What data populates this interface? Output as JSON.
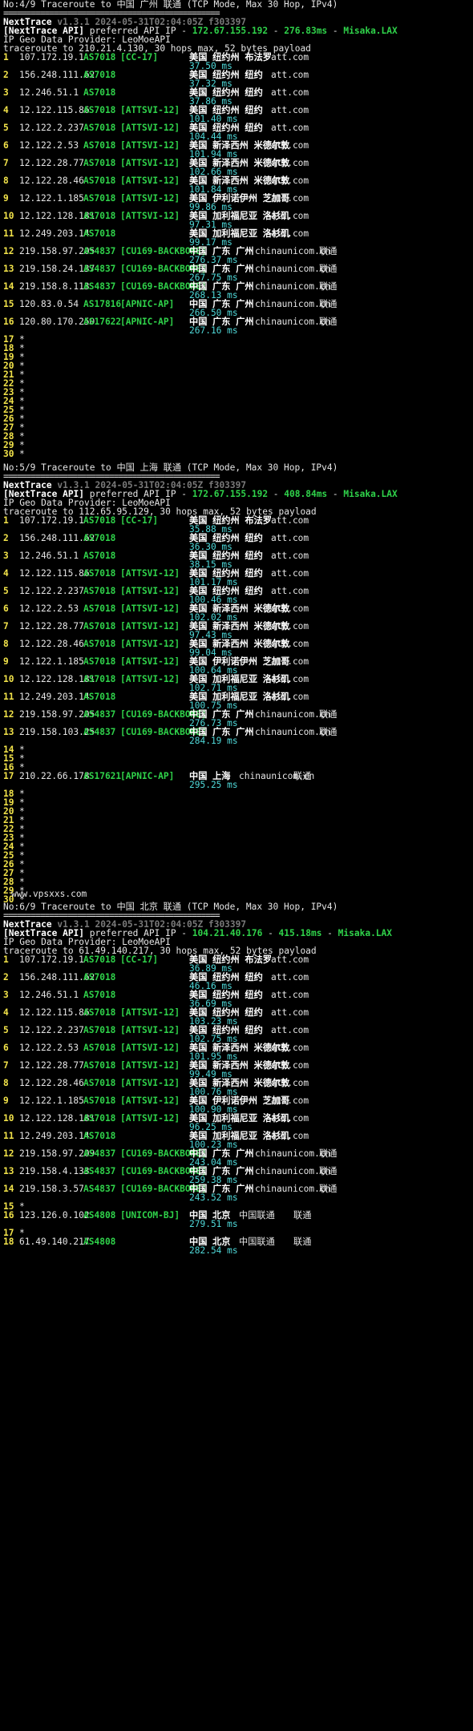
{
  "theme": {
    "background": "#000000",
    "hop_color": "#f2e34a",
    "asn_color": "#2fd24a",
    "rtt_color": "#4fd8d8",
    "version_color": "#7a7a7a"
  },
  "separator": "===============================================",
  "watermark": "www.vpsxxs.com",
  "sections": [
    {
      "heading": "No:4/9 Traceroute to 中国 广州 联通 (TCP Mode, Max 30 Hop, IPv4)",
      "brand": "NextTrace",
      "version": "v1.3.1 2024-05-31T02:04:05Z f303397",
      "api_prefix": "[NextTrace API]",
      "api_text": " preferred API IP - ",
      "api_ip": "172.67.155.192",
      "api_dash": " - ",
      "api_rtt": "276.83ms",
      "api_dash2": " - ",
      "api_node": "Misaka.LAX",
      "geo_provider": "IP Geo Data Provider: LeoMoeAPI",
      "trace_line": "traceroute to 210.21.4.130, 30 hops max, 52 bytes payload",
      "hops": [
        {
          "n": "1",
          "ip": "107.172.19.1",
          "as": "AS7018",
          "tag": "[CC-17]",
          "geo": "美国 纽约州 布法罗",
          "dom": "att.com",
          "isp": "",
          "rtt": "37.50 ms"
        },
        {
          "n": "2",
          "ip": "156.248.111.62",
          "as": "AS7018",
          "tag": "",
          "geo": "美国 纽约州 纽约",
          "dom": "att.com",
          "isp": "",
          "rtt": "37.32 ms"
        },
        {
          "n": "3",
          "ip": "12.246.51.1",
          "as": "AS7018",
          "tag": "",
          "geo": "美国 纽约州 纽约",
          "dom": "att.com",
          "isp": "",
          "rtt": "37.86 ms"
        },
        {
          "n": "4",
          "ip": "12.122.115.86",
          "as": "AS7018",
          "tag": "[ATTSVI-12]",
          "geo": "美国 纽约州 纽约",
          "dom": "att.com",
          "isp": "",
          "rtt": "101.40 ms"
        },
        {
          "n": "5",
          "ip": "12.122.2.237",
          "as": "AS7018",
          "tag": "[ATTSVI-12]",
          "geo": "美国 纽约州 纽约",
          "dom": "att.com",
          "isp": "",
          "rtt": "104.44 ms"
        },
        {
          "n": "6",
          "ip": "12.122.2.53",
          "as": "AS7018",
          "tag": "[ATTSVI-12]",
          "geo": "美国 新泽西州 米德尔敦",
          "dom": "att.com",
          "isp": "",
          "rtt": "101.94 ms"
        },
        {
          "n": "7",
          "ip": "12.122.28.77",
          "as": "AS7018",
          "tag": "[ATTSVI-12]",
          "geo": "美国 新泽西州 米德尔敦",
          "dom": "att.com",
          "isp": "",
          "rtt": "102.66 ms"
        },
        {
          "n": "8",
          "ip": "12.122.28.46",
          "as": "AS7018",
          "tag": "[ATTSVI-12]",
          "geo": "美国 新泽西州 米德尔敦",
          "dom": "att.com",
          "isp": "",
          "rtt": "101.84 ms"
        },
        {
          "n": "9",
          "ip": "12.122.1.185",
          "as": "AS7018",
          "tag": "[ATTSVI-12]",
          "geo": "美国 伊利诺伊州 芝加哥",
          "dom": "att.com",
          "isp": "",
          "rtt": "99.86 ms"
        },
        {
          "n": "10",
          "ip": "12.122.128.181",
          "as": "AS7018",
          "tag": "[ATTSVI-12]",
          "geo": "美国 加利福尼亚 洛杉矶",
          "dom": "att.com",
          "isp": "",
          "rtt": "97.31 ms"
        },
        {
          "n": "11",
          "ip": "12.249.203.14",
          "as": "AS7018",
          "tag": "",
          "geo": "美国 加利福尼亚 洛杉矶",
          "dom": "att.com",
          "isp": "",
          "rtt": "99.17 ms"
        },
        {
          "n": "12",
          "ip": "219.158.97.205",
          "as": "AS4837",
          "tag": "[CU169-BACKBONE]",
          "geo": "中国 广东 广州",
          "dom": "chinaunicom.cn",
          "isp": "联通",
          "rtt": "276.37 ms"
        },
        {
          "n": "13",
          "ip": "219.158.24.137",
          "as": "AS4837",
          "tag": "[CU169-BACKBONE]",
          "geo": "中国 广东 广州",
          "dom": "chinaunicom.cn",
          "isp": "联通",
          "rtt": "267.75 ms"
        },
        {
          "n": "14",
          "ip": "219.158.8.113",
          "as": "AS4837",
          "tag": "[CU169-BACKBONE]",
          "geo": "中国 广东 广州",
          "dom": "chinaunicom.cn",
          "isp": "联通",
          "rtt": "268.13 ms"
        },
        {
          "n": "15",
          "ip": "120.83.0.54",
          "as": "AS17816",
          "tag": "[APNIC-AP]",
          "geo": "中国 广东 广州",
          "dom": "chinaunicom.cn",
          "isp": "联通",
          "rtt": "266.50 ms"
        },
        {
          "n": "16",
          "ip": "120.80.170.250",
          "as": "AS17622",
          "tag": "[APNIC-AP]",
          "geo": "中国 广东 广州",
          "dom": "chinaunicom.cn",
          "isp": "联通",
          "rtt": "267.16 ms"
        },
        {
          "n": "17",
          "star": "*"
        },
        {
          "n": "18",
          "star": "*"
        },
        {
          "n": "19",
          "star": "*"
        },
        {
          "n": "20",
          "star": "*"
        },
        {
          "n": "21",
          "star": "*"
        },
        {
          "n": "22",
          "star": "*"
        },
        {
          "n": "23",
          "star": "*"
        },
        {
          "n": "24",
          "star": "*"
        },
        {
          "n": "25",
          "star": "*"
        },
        {
          "n": "26",
          "star": "*"
        },
        {
          "n": "27",
          "star": "*"
        },
        {
          "n": "28",
          "star": "*"
        },
        {
          "n": "29",
          "star": "*"
        },
        {
          "n": "30",
          "star": "*"
        }
      ]
    },
    {
      "heading": "No:5/9 Traceroute to 中国 上海 联通 (TCP Mode, Max 30 Hop, IPv4)",
      "brand": "NextTrace",
      "version": "v1.3.1 2024-05-31T02:04:05Z f303397",
      "api_prefix": "[NextTrace API]",
      "api_text": " preferred API IP - ",
      "api_ip": "172.67.155.192",
      "api_dash": " - ",
      "api_rtt": "408.84ms",
      "api_dash2": " - ",
      "api_node": "Misaka.LAX",
      "geo_provider": "IP Geo Data Provider: LeoMoeAPI",
      "trace_line": "traceroute to 112.65.95.129, 30 hops max, 52 bytes payload",
      "hops": [
        {
          "n": "1",
          "ip": "107.172.19.1",
          "as": "AS7018",
          "tag": "[CC-17]",
          "geo": "美国 纽约州 布法罗",
          "dom": "att.com",
          "isp": "",
          "rtt": "35.88 ms"
        },
        {
          "n": "2",
          "ip": "156.248.111.62",
          "as": "AS7018",
          "tag": "",
          "geo": "美国 纽约州 纽约",
          "dom": "att.com",
          "isp": "",
          "rtt": "36.30 ms"
        },
        {
          "n": "3",
          "ip": "12.246.51.1",
          "as": "AS7018",
          "tag": "",
          "geo": "美国 纽约州 纽约",
          "dom": "att.com",
          "isp": "",
          "rtt": "38.15 ms"
        },
        {
          "n": "4",
          "ip": "12.122.115.86",
          "as": "AS7018",
          "tag": "[ATTSVI-12]",
          "geo": "美国 纽约州 纽约",
          "dom": "att.com",
          "isp": "",
          "rtt": "101.17 ms"
        },
        {
          "n": "5",
          "ip": "12.122.2.237",
          "as": "AS7018",
          "tag": "[ATTSVI-12]",
          "geo": "美国 纽约州 纽约",
          "dom": "att.com",
          "isp": "",
          "rtt": "100.46 ms"
        },
        {
          "n": "6",
          "ip": "12.122.2.53",
          "as": "AS7018",
          "tag": "[ATTSVI-12]",
          "geo": "美国 新泽西州 米德尔敦",
          "dom": "att.com",
          "isp": "",
          "rtt": "102.02 ms"
        },
        {
          "n": "7",
          "ip": "12.122.28.77",
          "as": "AS7018",
          "tag": "[ATTSVI-12]",
          "geo": "美国 新泽西州 米德尔敦",
          "dom": "att.com",
          "isp": "",
          "rtt": "97.43 ms"
        },
        {
          "n": "8",
          "ip": "12.122.28.46",
          "as": "AS7018",
          "tag": "[ATTSVI-12]",
          "geo": "美国 新泽西州 米德尔敦",
          "dom": "att.com",
          "isp": "",
          "rtt": "99.04 ms"
        },
        {
          "n": "9",
          "ip": "12.122.1.185",
          "as": "AS7018",
          "tag": "[ATTSVI-12]",
          "geo": "美国 伊利诺伊州 芝加哥",
          "dom": "att.com",
          "isp": "",
          "rtt": "100.64 ms"
        },
        {
          "n": "10",
          "ip": "12.122.128.181",
          "as": "AS7018",
          "tag": "[ATTSVI-12]",
          "geo": "美国 加利福尼亚 洛杉矶",
          "dom": "att.com",
          "isp": "",
          "rtt": "102.71 ms"
        },
        {
          "n": "11",
          "ip": "12.249.203.14",
          "as": "AS7018",
          "tag": "",
          "geo": "美国 加利福尼亚 洛杉矶",
          "dom": "att.com",
          "isp": "",
          "rtt": "100.75 ms"
        },
        {
          "n": "12",
          "ip": "219.158.97.205",
          "as": "AS4837",
          "tag": "[CU169-BACKBONE]",
          "geo": "中国 广东 广州",
          "dom": "chinaunicom.cn",
          "isp": "联通",
          "rtt": "276.73 ms"
        },
        {
          "n": "13",
          "ip": "219.158.103.25",
          "as": "AS4837",
          "tag": "[CU169-BACKBONE]",
          "geo": "中国 广东 广州",
          "dom": "chinaunicom.cn",
          "isp": "联通",
          "rtt": "284.19 ms"
        },
        {
          "n": "14",
          "star": "*"
        },
        {
          "n": "15",
          "star": "*"
        },
        {
          "n": "16",
          "star": "*"
        },
        {
          "n": "17",
          "ip": "210.22.66.178",
          "as": "AS17621",
          "tag": "[APNIC-AP]",
          "geo": "中国 上海",
          "dom": "chinaunicom.cn",
          "isp": "联通",
          "rtt": "295.25 ms"
        },
        {
          "n": "18",
          "star": "*"
        },
        {
          "n": "19",
          "star": "*"
        },
        {
          "n": "20",
          "star": "*"
        },
        {
          "n": "21",
          "star": "*"
        },
        {
          "n": "22",
          "star": "*"
        },
        {
          "n": "23",
          "star": "*"
        },
        {
          "n": "24",
          "star": "*"
        },
        {
          "n": "25",
          "star": "*"
        },
        {
          "n": "26",
          "star": "*"
        },
        {
          "n": "27",
          "star": "*"
        },
        {
          "n": "28",
          "star": "*"
        },
        {
          "n": "29",
          "star": "*"
        },
        {
          "n": "30",
          "star": "*"
        }
      ]
    },
    {
      "heading": "No:6/9 Traceroute to 中国 北京 联通 (TCP Mode, Max 30 Hop, IPv4)",
      "brand": "NextTrace",
      "version": "v1.3.1 2024-05-31T02:04:05Z f303397",
      "api_prefix": "[NextTrace API]",
      "api_text": " preferred API IP - ",
      "api_ip": "104.21.40.176",
      "api_dash": " - ",
      "api_rtt": "415.18ms",
      "api_dash2": " - ",
      "api_node": "Misaka.LAX",
      "geo_provider": "IP Geo Data Provider: LeoMoeAPI",
      "trace_line": "traceroute to 61.49.140.217, 30 hops max, 52 bytes payload",
      "hops": [
        {
          "n": "1",
          "ip": "107.172.19.1",
          "as": "AS7018",
          "tag": "[CC-17]",
          "geo": "美国 纽约州 布法罗",
          "dom": "att.com",
          "isp": "",
          "rtt": "36.89 ms"
        },
        {
          "n": "2",
          "ip": "156.248.111.62",
          "as": "AS7018",
          "tag": "",
          "geo": "美国 纽约州 纽约",
          "dom": "att.com",
          "isp": "",
          "rtt": "46.16 ms"
        },
        {
          "n": "3",
          "ip": "12.246.51.1",
          "as": "AS7018",
          "tag": "",
          "geo": "美国 纽约州 纽约",
          "dom": "att.com",
          "isp": "",
          "rtt": "36.69 ms"
        },
        {
          "n": "4",
          "ip": "12.122.115.86",
          "as": "AS7018",
          "tag": "[ATTSVI-12]",
          "geo": "美国 纽约州 纽约",
          "dom": "att.com",
          "isp": "",
          "rtt": "103.23 ms"
        },
        {
          "n": "5",
          "ip": "12.122.2.237",
          "as": "AS7018",
          "tag": "[ATTSVI-12]",
          "geo": "美国 纽约州 纽约",
          "dom": "att.com",
          "isp": "",
          "rtt": "102.75 ms"
        },
        {
          "n": "6",
          "ip": "12.122.2.53",
          "as": "AS7018",
          "tag": "[ATTSVI-12]",
          "geo": "美国 新泽西州 米德尔敦",
          "dom": "att.com",
          "isp": "",
          "rtt": "101.95 ms"
        },
        {
          "n": "7",
          "ip": "12.122.28.77",
          "as": "AS7018",
          "tag": "[ATTSVI-12]",
          "geo": "美国 新泽西州 米德尔敦",
          "dom": "att.com",
          "isp": "",
          "rtt": "99.49 ms"
        },
        {
          "n": "8",
          "ip": "12.122.28.46",
          "as": "AS7018",
          "tag": "[ATTSVI-12]",
          "geo": "美国 新泽西州 米德尔敦",
          "dom": "att.com",
          "isp": "",
          "rtt": "100.76 ms"
        },
        {
          "n": "9",
          "ip": "12.122.1.185",
          "as": "AS7018",
          "tag": "[ATTSVI-12]",
          "geo": "美国 伊利诺伊州 芝加哥",
          "dom": "att.com",
          "isp": "",
          "rtt": "100.90 ms"
        },
        {
          "n": "10",
          "ip": "12.122.128.181",
          "as": "AS7018",
          "tag": "[ATTSVI-12]",
          "geo": "美国 加利福尼亚 洛杉矶",
          "dom": "att.com",
          "isp": "",
          "rtt": "96.25 ms"
        },
        {
          "n": "11",
          "ip": "12.249.203.14",
          "as": "AS7018",
          "tag": "",
          "geo": "美国 加利福尼亚 洛杉矶",
          "dom": "att.com",
          "isp": "",
          "rtt": "100.23 ms"
        },
        {
          "n": "12",
          "ip": "219.158.97.209",
          "as": "AS4837",
          "tag": "[CU169-BACKBONE]",
          "geo": "中国 广东 广州",
          "dom": "chinaunicom.cn",
          "isp": "联通",
          "rtt": "243.04 ms"
        },
        {
          "n": "13",
          "ip": "219.158.4.133",
          "as": "AS4837",
          "tag": "[CU169-BACKBONE]",
          "geo": "中国 广东 广州",
          "dom": "chinaunicom.cn",
          "isp": "联通",
          "rtt": "259.38 ms"
        },
        {
          "n": "14",
          "ip": "219.158.3.57",
          "as": "AS4837",
          "tag": "[CU169-BACKBONE]",
          "geo": "中国 广东 广州",
          "dom": "chinaunicom.cn",
          "isp": "联通",
          "rtt": "243.52 ms"
        },
        {
          "n": "15",
          "star": "*"
        },
        {
          "n": "16",
          "ip": "123.126.0.102",
          "as": "AS4808",
          "tag": "[UNICOM-BJ]",
          "geo": "中国 北京",
          "dom": "中国联通",
          "isp": "联通",
          "rtt": "279.51 ms"
        },
        {
          "n": "17",
          "star": "*"
        },
        {
          "n": "18",
          "ip": "61.49.140.217",
          "as": "AS4808",
          "tag": "",
          "geo": "中国 北京",
          "dom": "中国联通",
          "isp": "联通",
          "rtt": "282.54 ms"
        }
      ]
    }
  ]
}
